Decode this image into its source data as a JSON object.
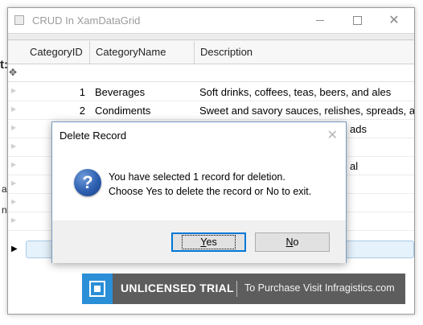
{
  "window": {
    "title": "CRUD In XamDataGrid"
  },
  "grid": {
    "columns": [
      "CategoryID",
      "CategoryName",
      "Description"
    ],
    "rows": [
      {
        "id": "1",
        "name": "Beverages",
        "description": "Soft drinks, coffees, teas, beers, and ales"
      },
      {
        "id": "2",
        "name": "Condiments",
        "description": "Sweet and savory sauces, relishes, spreads, and s"
      }
    ],
    "partial_texts": {
      "row3_desc_tail": "ads",
      "row5_desc_tail": "al"
    }
  },
  "background_fragments": [
    "t:",
    "a",
    "n"
  ],
  "trial_banner": {
    "title": "UNLICENSED TRIAL",
    "subtitle": "To Purchase Visit Infragistics.com"
  },
  "dialog": {
    "title": "Delete Record",
    "line1": "You have selected 1 record for deletion.",
    "line2": "Choose Yes to delete the record or No to exit.",
    "yes_mnemonic": "Y",
    "yes_rest": "es",
    "no_mnemonic": "N",
    "no_rest": "o",
    "icon_glyph": "?"
  },
  "colors": {
    "accent": "#0078d7",
    "banner_bg": "#5d5d5d",
    "banner_logo": "#2a8fd6",
    "summary_bar": "#e5f1fb"
  }
}
